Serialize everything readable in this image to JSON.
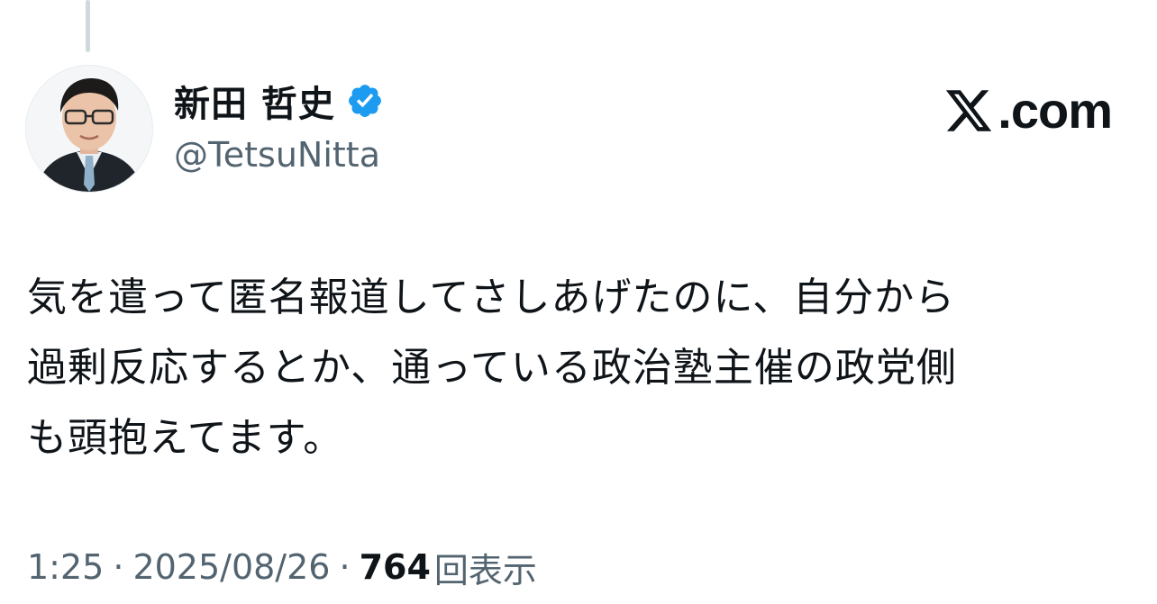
{
  "post": {
    "author": {
      "display_name": "新田 哲史",
      "handle": "@TetsuNitta",
      "verified": true,
      "avatar_icon": "person-avatar"
    },
    "brand": {
      "label": ".com",
      "logo_icon": "x-logo-icon"
    },
    "text_lines": [
      "気を遣って匿名報道してさしあげたのに、自分から",
      "過剰反応するとか、通っている政治塾主催の政党側",
      "も頭抱えてます。"
    ],
    "meta": {
      "time": "1:25",
      "separator": "·",
      "date": "2025/08/26",
      "views_count": "764",
      "views_label": "回表示"
    }
  },
  "colors": {
    "text_primary": "#0f1419",
    "text_secondary": "#536471",
    "verified_blue": "#1d9bf0",
    "thread_line": "#cfd9de",
    "background": "#ffffff"
  }
}
